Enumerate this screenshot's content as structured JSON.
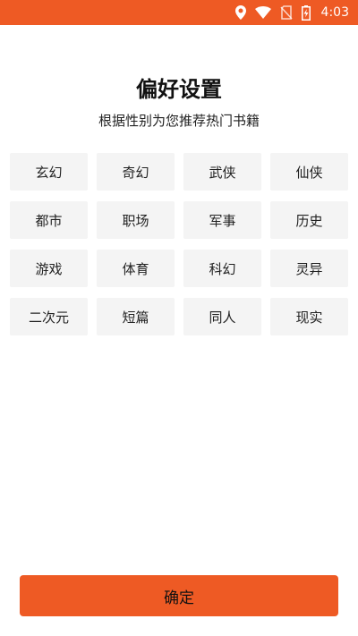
{
  "status_bar": {
    "time": "4:03",
    "icons": [
      "location-icon",
      "wifi-icon",
      "no-sim-icon",
      "battery-charging-icon"
    ]
  },
  "header": {
    "title": "偏好设置",
    "subtitle": "根据性别为您推荐热门书籍"
  },
  "genres": [
    "玄幻",
    "奇幻",
    "武侠",
    "仙侠",
    "都市",
    "职场",
    "军事",
    "历史",
    "游戏",
    "体育",
    "科幻",
    "灵异",
    "二次元",
    "短篇",
    "同人",
    "现实"
  ],
  "actions": {
    "confirm_label": "确定"
  },
  "colors": {
    "accent": "#ee5a24",
    "tile_background": "#f4f4f4"
  }
}
